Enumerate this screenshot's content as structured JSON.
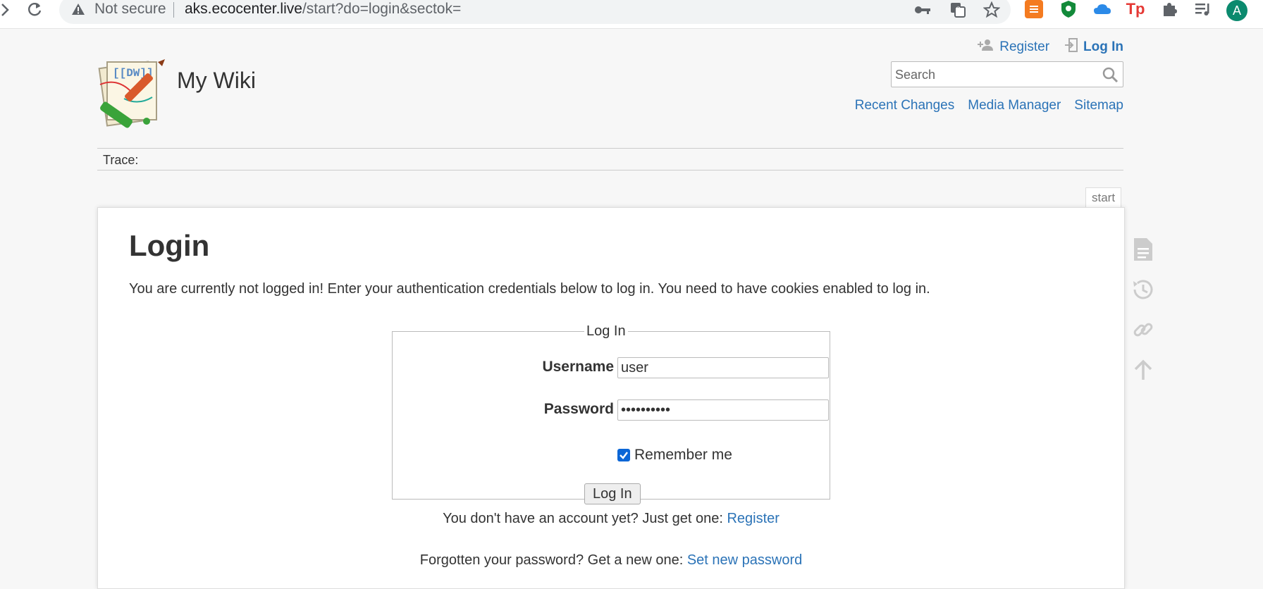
{
  "browser": {
    "security_label": "Not secure",
    "url_host": "aks.ecocenter.live",
    "url_path": "/start?do=login&sectok=",
    "avatar_letter": "A",
    "ext_tp_label": "Tp"
  },
  "header": {
    "site_title": "My Wiki",
    "user_tools": {
      "register": "Register",
      "login": "Log In"
    },
    "search": {
      "placeholder": "Search"
    },
    "site_tools": [
      "Recent Changes",
      "Media Manager",
      "Sitemap"
    ]
  },
  "trace": {
    "label": "Trace:"
  },
  "page": {
    "id": "start",
    "title": "Login",
    "intro": "You are currently not logged in! Enter your authentication credentials below to log in. You need to have cookies enabled to log in.",
    "form": {
      "legend": "Log In",
      "username_label": "Username",
      "username_value": "user",
      "password_label": "Password",
      "password_value": "••••••••••",
      "remember_label": "Remember me",
      "remember_checked": true,
      "submit_label": "Log In"
    },
    "register_prompt": "You don't have an account yet? Just get one:",
    "register_link": "Register",
    "reset_prompt": "Forgotten your password? Get a new one:",
    "reset_link": "Set new password"
  },
  "page_tools": [
    "show-page-icon",
    "old-revisions-icon",
    "backlinks-icon",
    "back-to-top-icon"
  ],
  "colors": {
    "link": "#2b73b7",
    "text": "#333333",
    "background": "#f7f7f7",
    "checkbox": "#0b66d6"
  }
}
